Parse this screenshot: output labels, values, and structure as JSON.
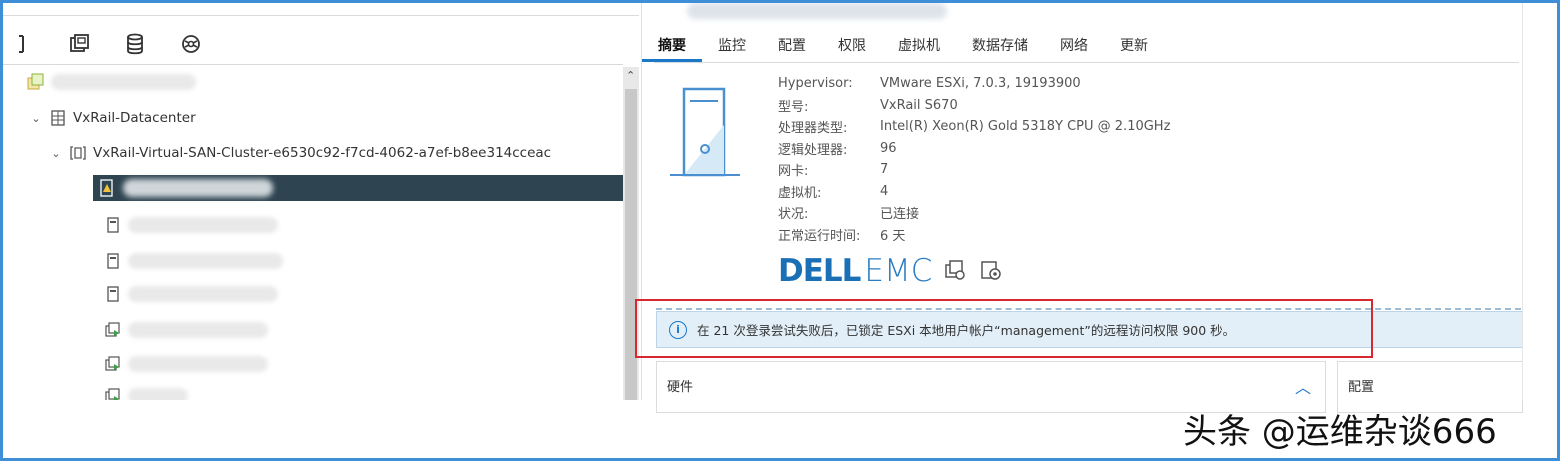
{
  "nav_icons": [
    "hosts-clusters-icon",
    "vms-templates-icon",
    "storage-icon",
    "networking-icon"
  ],
  "tree": {
    "root_label_blurred": true,
    "datacenter": "VxRail-Datacenter",
    "cluster": "VxRail-Virtual-SAN-Cluster-e6530c92-f7cd-4062-a7ef-b8ee314cceac"
  },
  "tabs": [
    "摘要",
    "监控",
    "配置",
    "权限",
    "虚拟机",
    "数据存储",
    "网络",
    "更新"
  ],
  "active_tab": "摘要",
  "summary": [
    {
      "label": "Hypervisor:",
      "value": "VMware ESXi, 7.0.3, 19193900"
    },
    {
      "label": "型号:",
      "value": "VxRail S670"
    },
    {
      "label": "处理器类型:",
      "value": "Intel(R) Xeon(R) Gold 5318Y CPU @ 2.10GHz"
    },
    {
      "label": "逻辑处理器:",
      "value": "96"
    },
    {
      "label": "网卡:",
      "value": "7"
    },
    {
      "label": "虚拟机:",
      "value": "4"
    },
    {
      "label": "状况:",
      "value": "已连接"
    },
    {
      "label": "正常运行时间:",
      "value": "6 天"
    }
  ],
  "brand": {
    "dell": "DELL",
    "emc": "EMC"
  },
  "alert": {
    "text": "在 21 次登录尝试失败后，已锁定 ESXi 本地用户帐户“management”的远程访问权限 900 秒。"
  },
  "panels": {
    "hardware": "硬件",
    "configuration": "配置"
  },
  "watermark": "头条 @运维杂谈666",
  "colors": {
    "accent": "#1b78c8",
    "selected_row": "#2e4450",
    "alert_bg": "#e2eff8",
    "highlight_box": "#d7282f",
    "frame": "#3f8fd8"
  }
}
